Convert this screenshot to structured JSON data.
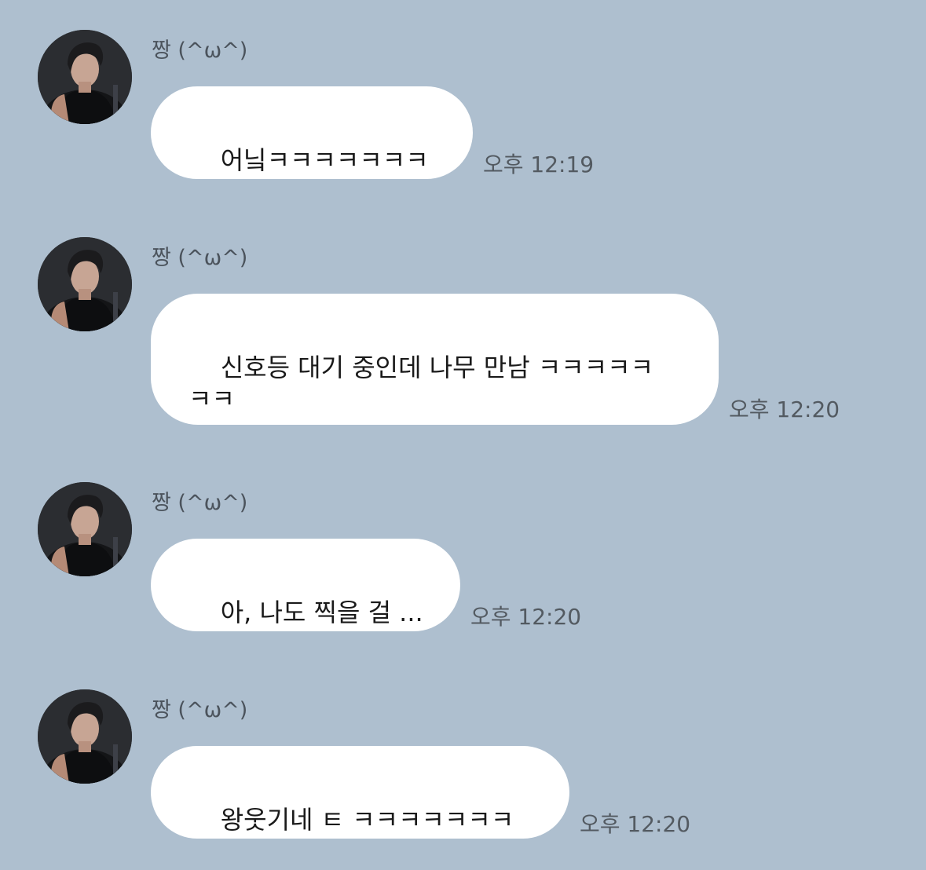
{
  "messages": [
    {
      "sender": "짱 (^ω^)",
      "text": "어닠ㅋㅋㅋㅋㅋㅋㅋ",
      "time": "오후 12:19"
    },
    {
      "sender": "짱 (^ω^)",
      "text": "신호등 대기 중인데 나무 만남 ㅋㅋㅋㅋㅋ\nㅋㅋ",
      "time": "오후 12:20"
    },
    {
      "sender": "짱 (^ω^)",
      "text": "아, 나도 찍을 걸 ...",
      "time": "오후 12:20"
    },
    {
      "sender": "짱 (^ω^)",
      "text": "왕웃기네 ㅌ ㅋㅋㅋㅋㅋㅋㅋ",
      "time": "오후 12:20"
    }
  ],
  "colors": {
    "background": "#aebfcf",
    "bubble": "#ffffff",
    "text": "#1a1a1a",
    "meta": "#535a61"
  }
}
